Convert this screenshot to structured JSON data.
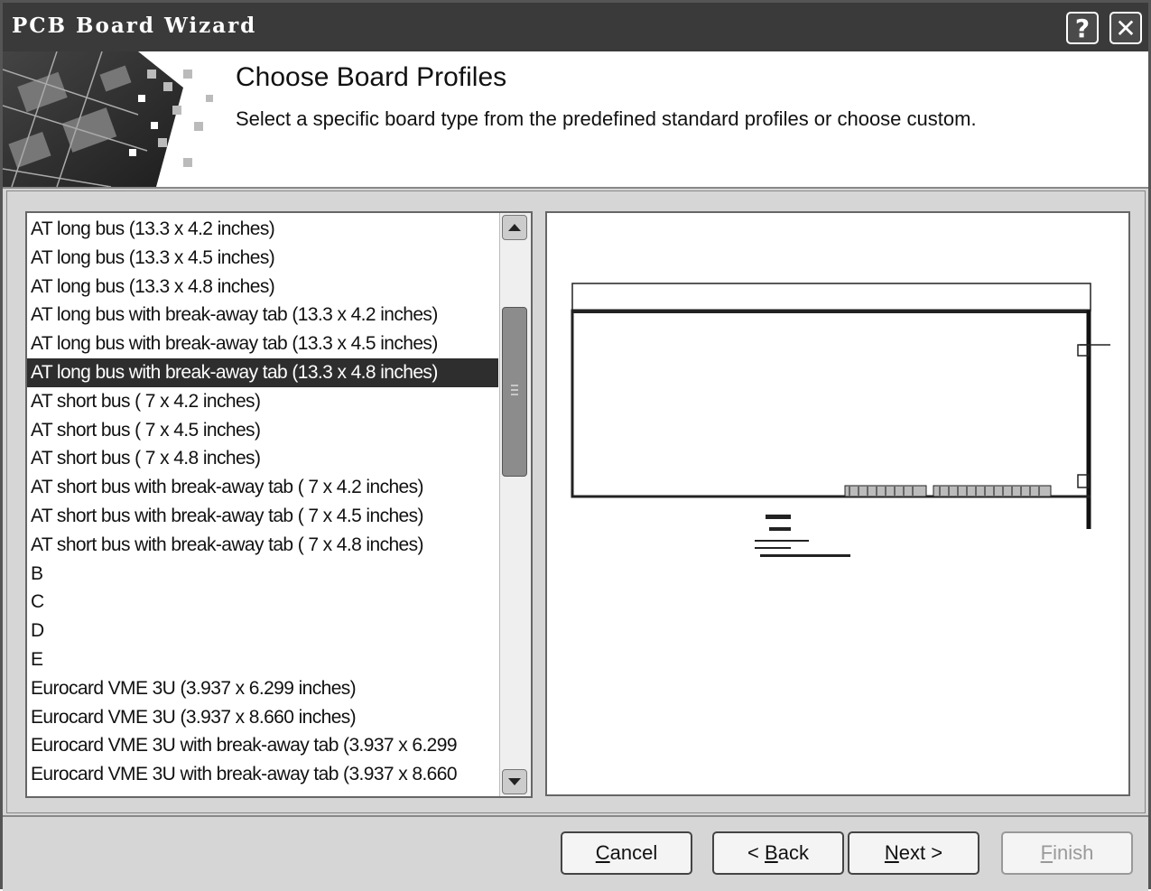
{
  "window": {
    "title": "PCB Board Wizard",
    "help_glyph": "?",
    "close_glyph": "✕"
  },
  "header": {
    "title": "Choose Board Profiles",
    "subtitle": "Select a specific board type from the predefined standard profiles or choose custom."
  },
  "profiles": {
    "selected_index": 5,
    "items": [
      "AT long bus (13.3 x 4.2 inches)",
      "AT long bus (13.3 x 4.5 inches)",
      "AT long bus (13.3 x 4.8 inches)",
      "AT long bus with break-away tab (13.3 x 4.2 inches)",
      "AT long bus with break-away tab (13.3 x 4.5 inches)",
      "AT long bus with break-away tab (13.3 x 4.8 inches)",
      "AT short bus ( 7 x 4.2 inches)",
      "AT short bus ( 7 x 4.5 inches)",
      "AT short bus ( 7 x 4.8 inches)",
      "AT short bus with break-away tab ( 7 x 4.2 inches)",
      "AT short bus with break-away tab ( 7 x 4.5 inches)",
      "AT short bus with break-away tab ( 7 x 4.8 inches)",
      "B",
      "C",
      "D",
      "E",
      "Eurocard VME 3U (3.937 x 6.299 inches)",
      "Eurocard VME 3U (3.937 x 8.660 inches)",
      "Eurocard VME 3U with break-away tab (3.937 x 6.299",
      "Eurocard VME 3U with break-away tab (3.937 x 8.660"
    ]
  },
  "buttons": {
    "cancel": {
      "accel": "C",
      "rest": "ancel"
    },
    "back": {
      "pre": "< ",
      "accel": "B",
      "rest": "ack"
    },
    "next": {
      "accel": "N",
      "rest": "ext >"
    },
    "finish": {
      "accel": "F",
      "rest": "inish"
    }
  }
}
